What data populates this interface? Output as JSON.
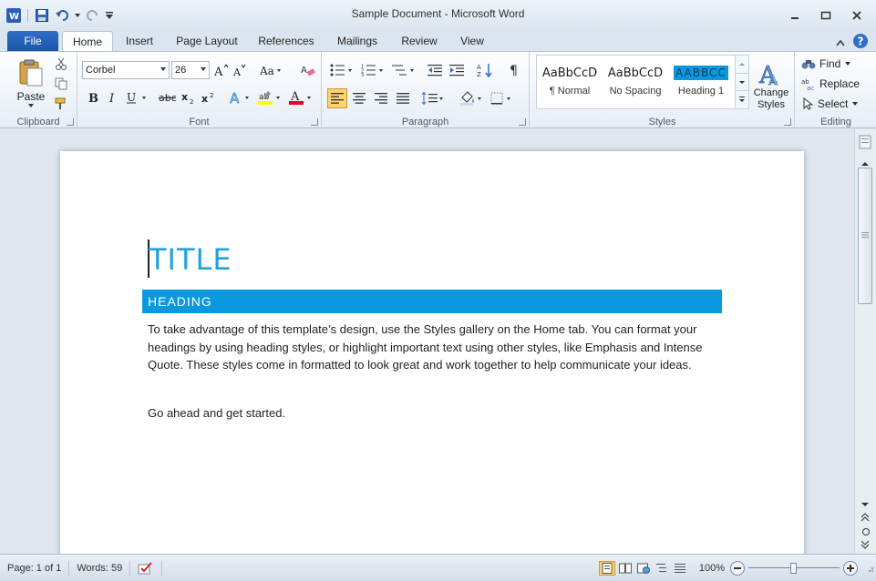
{
  "window": {
    "title": "Sample Document  -  Microsoft Word"
  },
  "tabs": [
    "File",
    "Home",
    "Insert",
    "Page Layout",
    "References",
    "Mailings",
    "Review",
    "View"
  ],
  "ribbon": {
    "clipboard": {
      "label": "Clipboard",
      "paste": "Paste"
    },
    "font": {
      "label": "Font",
      "family": "Corbel",
      "size": "26"
    },
    "paragraph": {
      "label": "Paragraph"
    },
    "styles": {
      "label": "Styles",
      "items": [
        {
          "sample": "AaBbCcD",
          "name": "¶ Normal"
        },
        {
          "sample": "AaBbCcD",
          "name": "No Spacing"
        },
        {
          "sample": "AABBCC",
          "name": "Heading 1"
        }
      ],
      "change": [
        "Change",
        "Styles"
      ]
    },
    "editing": {
      "label": "Editing",
      "find": "Find",
      "replace": "Replace",
      "select": "Select"
    }
  },
  "document": {
    "title": "TITLE",
    "heading": "HEADING",
    "paragraphs": [
      "To take advantage of this template’s design, use the Styles gallery on the Home tab. You can format your headings by using heading styles, or highlight important text using other styles, like Emphasis and Intense Quote. These styles come in formatted to look great and work together to help communicate your ideas.",
      "Go ahead and get started."
    ]
  },
  "status": {
    "page": "Page: 1 of 1",
    "words": "Words: 59",
    "zoom": "100%"
  },
  "colors": {
    "accent": "#1fa3dd",
    "heading_bg": "#0a98de",
    "file_tab": "#1d56aa"
  }
}
